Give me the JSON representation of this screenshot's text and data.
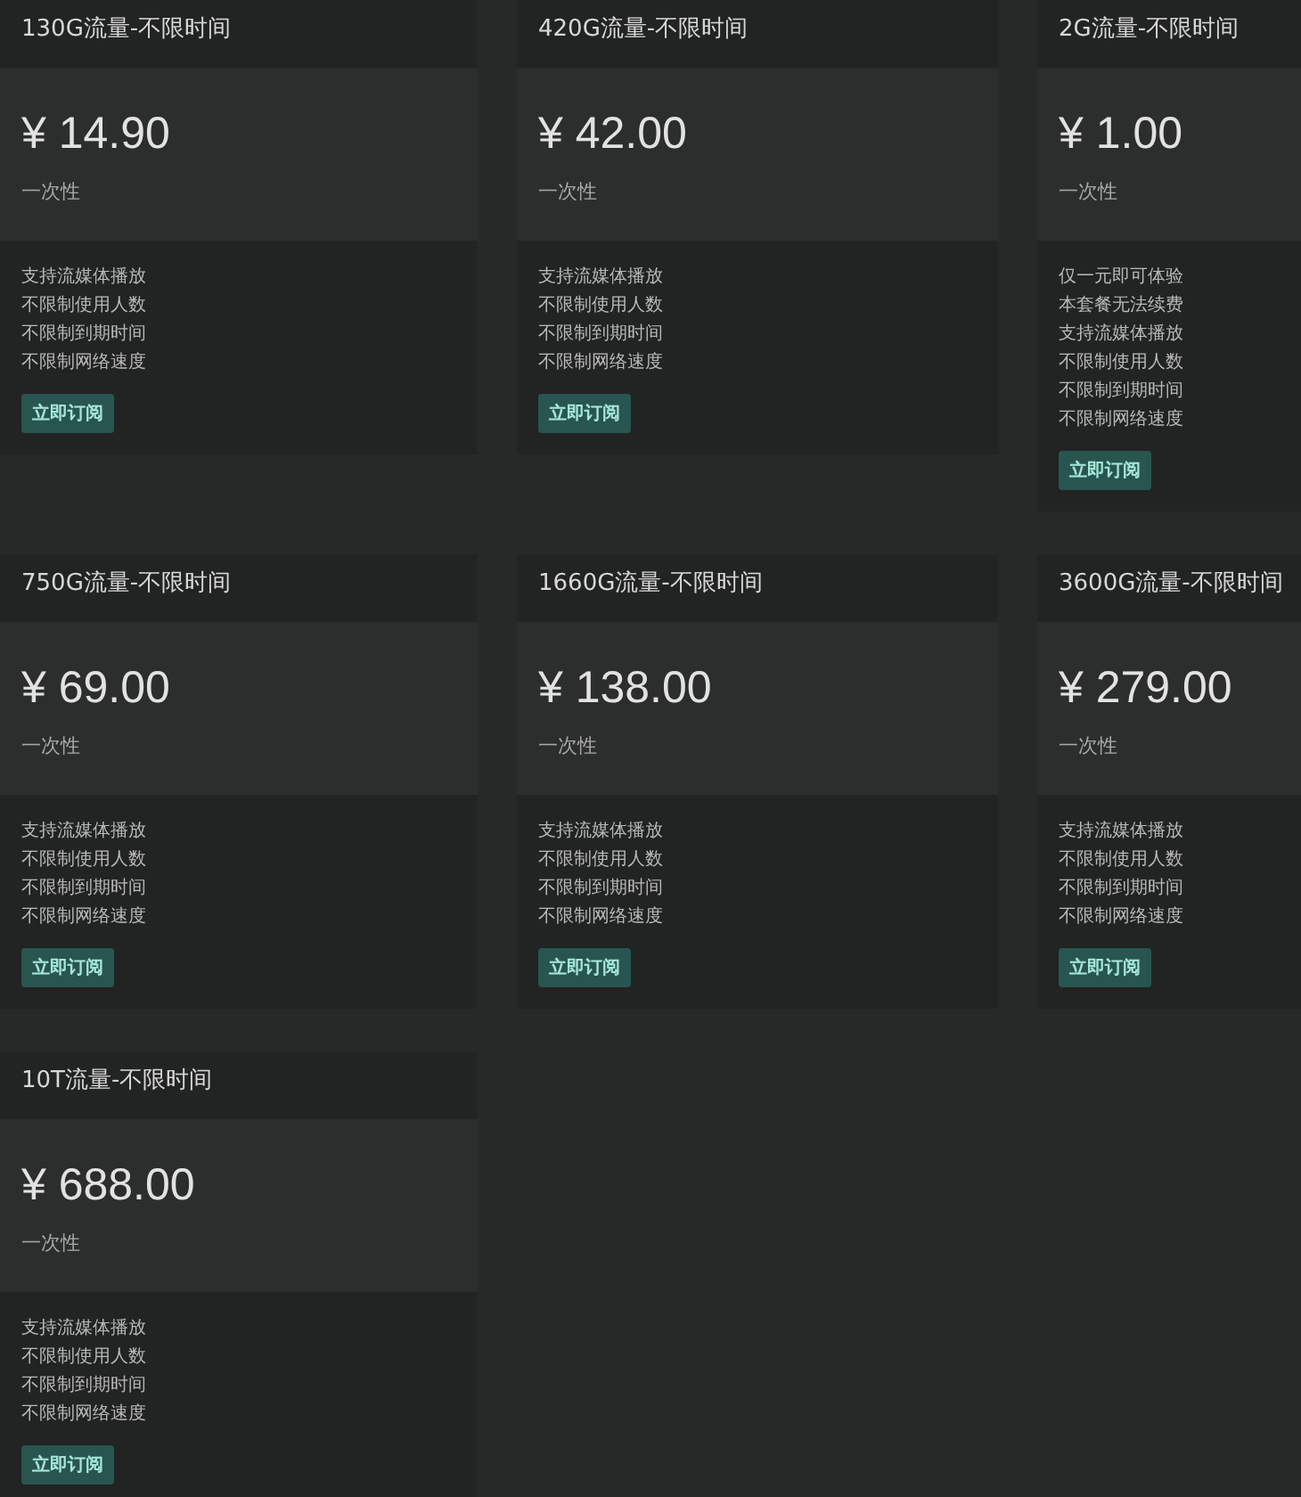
{
  "plans": [
    {
      "title": "130G流量-不限时间",
      "price": "¥ 14.90",
      "period": "一次性",
      "features": [
        "支持流媒体播放",
        "不限制使用人数",
        "不限制到期时间",
        "不限制网络速度"
      ],
      "button": "立即订阅"
    },
    {
      "title": "420G流量-不限时间",
      "price": "¥ 42.00",
      "period": "一次性",
      "features": [
        "支持流媒体播放",
        "不限制使用人数",
        "不限制到期时间",
        "不限制网络速度"
      ],
      "button": "立即订阅"
    },
    {
      "title": "2G流量-不限时间",
      "price": "¥ 1.00",
      "period": "一次性",
      "features": [
        "仅一元即可体验",
        "本套餐无法续费",
        "支持流媒体播放",
        "不限制使用人数",
        "不限制到期时间",
        "不限制网络速度"
      ],
      "button": "立即订阅"
    },
    {
      "title": "750G流量-不限时间",
      "price": "¥ 69.00",
      "period": "一次性",
      "features": [
        "支持流媒体播放",
        "不限制使用人数",
        "不限制到期时间",
        "不限制网络速度"
      ],
      "button": "立即订阅"
    },
    {
      "title": "1660G流量-不限时间",
      "price": "¥ 138.00",
      "period": "一次性",
      "features": [
        "支持流媒体播放",
        "不限制使用人数",
        "不限制到期时间",
        "不限制网络速度"
      ],
      "button": "立即订阅"
    },
    {
      "title": "3600G流量-不限时间",
      "price": "¥ 279.00",
      "period": "一次性",
      "features": [
        "支持流媒体播放",
        "不限制使用人数",
        "不限制到期时间",
        "不限制网络速度"
      ],
      "button": "立即订阅"
    },
    {
      "title": "10T流量-不限时间",
      "price": "¥ 688.00",
      "period": "一次性",
      "features": [
        "支持流媒体播放",
        "不限制使用人数",
        "不限制到期时间",
        "不限制网络速度"
      ],
      "button": "立即订阅"
    }
  ]
}
